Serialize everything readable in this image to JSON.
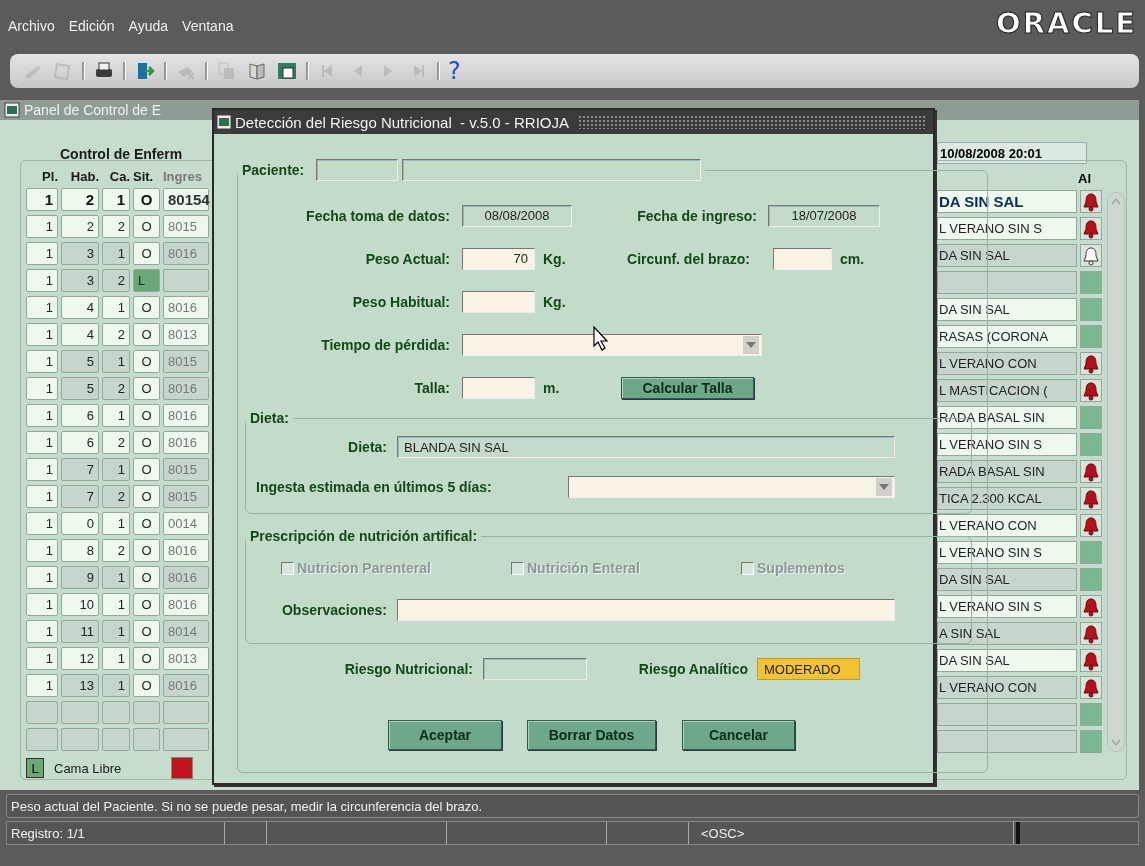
{
  "menu": [
    {
      "label": "Archivo"
    },
    {
      "label": "Edición"
    },
    {
      "label": "Ayuda"
    },
    {
      "label": "Ventana"
    }
  ],
  "logo": "ORACLE",
  "toolbar": [
    {
      "kind": "pen",
      "disabled": true
    },
    {
      "kind": "save",
      "disabled": true
    },
    {
      "kind": "separator"
    },
    {
      "kind": "print",
      "disabled": false
    },
    {
      "kind": "separator"
    },
    {
      "kind": "exit",
      "disabled": false
    },
    {
      "kind": "separator"
    },
    {
      "kind": "clear",
      "disabled": true
    },
    {
      "kind": "separator"
    },
    {
      "kind": "list",
      "disabled": true
    },
    {
      "kind": "book",
      "disabled": false
    },
    {
      "kind": "helpwindow",
      "disabled": false
    },
    {
      "kind": "separator"
    },
    {
      "kind": "first",
      "disabled": true
    },
    {
      "kind": "prev",
      "disabled": true
    },
    {
      "kind": "next",
      "disabled": true
    },
    {
      "kind": "last",
      "disabled": true
    },
    {
      "kind": "separator"
    },
    {
      "kind": "help",
      "label": "?",
      "disabled": false
    }
  ],
  "background_window": {
    "title": "Panel de Control de E",
    "group_title": "Control de Enferm",
    "datetime": "10/08/2008 20:01",
    "columns": [
      "Pl.",
      "Hab.",
      "Ca.",
      "Sit.",
      "Ingres"
    ],
    "alert_column": "Al",
    "rows": [
      {
        "kind": "patient",
        "pl": "1",
        "hab": "2",
        "ca": "1",
        "sit": "O",
        "ingreso": "80154",
        "dieta": "DA SIN SAL",
        "bell": true,
        "bell_filled": true,
        "current": true,
        "shaded": false,
        "free": false
      },
      {
        "kind": "patient",
        "pl": "1",
        "hab": "2",
        "ca": "2",
        "sit": "O",
        "ingreso": "8015",
        "dieta": "L VERANO SIN S",
        "bell": true,
        "bell_filled": true,
        "current": false,
        "shaded": false,
        "free": false
      },
      {
        "kind": "patient",
        "pl": "1",
        "hab": "3",
        "ca": "1",
        "sit": "O",
        "ingreso": "8016",
        "dieta": "DA SIN SAL",
        "bell": true,
        "bell_filled": false,
        "current": false,
        "shaded": true,
        "free": false
      },
      {
        "kind": "patient",
        "pl": "1",
        "hab": "3",
        "ca": "2",
        "sit": "L",
        "bell": false,
        "current": false,
        "shaded": true,
        "free": true
      },
      {
        "kind": "patient",
        "pl": "1",
        "hab": "4",
        "ca": "1",
        "sit": "O",
        "ingreso": "8016",
        "dieta": "DA SIN SAL",
        "bell": false,
        "current": false,
        "shaded": false,
        "free": false
      },
      {
        "kind": "patient",
        "pl": "1",
        "hab": "4",
        "ca": "2",
        "sit": "O",
        "ingreso": "8013",
        "dieta": "RASAS (CORONA",
        "bell": false,
        "current": false,
        "shaded": false,
        "free": false
      },
      {
        "kind": "patient",
        "pl": "1",
        "hab": "5",
        "ca": "1",
        "sit": "O",
        "ingreso": "8015",
        "dieta": "L VERANO CON",
        "bell": true,
        "bell_filled": true,
        "current": false,
        "shaded": true,
        "free": false
      },
      {
        "kind": "patient",
        "pl": "1",
        "hab": "5",
        "ca": "2",
        "sit": "O",
        "ingreso": "8016",
        "dieta": "L MASTICACION (",
        "bell": true,
        "bell_filled": true,
        "current": false,
        "shaded": true,
        "free": false
      },
      {
        "kind": "patient",
        "pl": "1",
        "hab": "6",
        "ca": "1",
        "sit": "O",
        "ingreso": "8016",
        "dieta": "RADA BASAL SIN",
        "bell": false,
        "current": false,
        "shaded": false,
        "free": false
      },
      {
        "kind": "patient",
        "pl": "1",
        "hab": "6",
        "ca": "2",
        "sit": "O",
        "ingreso": "8016",
        "dieta": "L VERANO SIN S",
        "bell": false,
        "current": false,
        "shaded": false,
        "free": false
      },
      {
        "kind": "patient",
        "pl": "1",
        "hab": "7",
        "ca": "1",
        "sit": "O",
        "ingreso": "8015",
        "dieta": "RADA BASAL SIN",
        "bell": true,
        "bell_filled": true,
        "current": false,
        "shaded": true,
        "free": false
      },
      {
        "kind": "patient",
        "pl": "1",
        "hab": "7",
        "ca": "2",
        "sit": "O",
        "ingreso": "8015",
        "dieta": "TICA 2.300 KCAL",
        "bell": true,
        "bell_filled": true,
        "current": false,
        "shaded": true,
        "free": false
      },
      {
        "kind": "patient",
        "pl": "1",
        "hab": "0",
        "ca": "1",
        "sit": "O",
        "ingreso": "0014",
        "dieta": "L VERANO CON",
        "bell": true,
        "bell_filled": true,
        "current": false,
        "shaded": false,
        "free": false
      },
      {
        "kind": "patient",
        "pl": "1",
        "hab": "8",
        "ca": "2",
        "sit": "O",
        "ingreso": "8016",
        "dieta": "L VERANO SIN S",
        "bell": false,
        "current": false,
        "shaded": false,
        "free": false
      },
      {
        "kind": "patient",
        "pl": "1",
        "hab": "9",
        "ca": "1",
        "sit": "O",
        "ingreso": "8016",
        "dieta": "DA SIN SAL",
        "bell": false,
        "current": false,
        "shaded": true,
        "free": false
      },
      {
        "kind": "patient",
        "pl": "1",
        "hab": "10",
        "ca": "1",
        "sit": "O",
        "ingreso": "8016",
        "dieta": "L VERANO SIN S",
        "bell": true,
        "bell_filled": true,
        "current": false,
        "shaded": false,
        "free": false
      },
      {
        "kind": "patient",
        "pl": "1",
        "hab": "11",
        "ca": "1",
        "sit": "O",
        "ingreso": "8014",
        "dieta": "A SIN SAL",
        "bell": true,
        "bell_filled": true,
        "current": false,
        "shaded": true,
        "free": false
      },
      {
        "kind": "patient",
        "pl": "1",
        "hab": "12",
        "ca": "1",
        "sit": "O",
        "ingreso": "8013",
        "dieta": "DA SIN SAL",
        "bell": true,
        "bell_filled": true,
        "current": false,
        "shaded": false,
        "free": false
      },
      {
        "kind": "patient",
        "pl": "1",
        "hab": "13",
        "ca": "1",
        "sit": "O",
        "ingreso": "8016",
        "dieta": "L VERANO CON",
        "bell": true,
        "bell_filled": true,
        "current": false,
        "shaded": true,
        "free": false
      },
      {
        "kind": "blank"
      },
      {
        "kind": "blank"
      }
    ],
    "legend": [
      {
        "kind": "free",
        "swatch": "L",
        "label": "Cama Libre"
      },
      {
        "kind": "alert"
      }
    ]
  },
  "dialog": {
    "title": "Detección del Riesgo Nutricional  - v.5.0 - RRIOJA",
    "patient_label": "Paciente:",
    "fecha_toma": {
      "label": "Fecha toma de datos:",
      "value": "08/08/2008",
      "readonly": true
    },
    "fecha_ingreso": {
      "label": "Fecha de ingreso:",
      "value": "18/07/2008",
      "readonly": true
    },
    "peso_actual": {
      "label": "Peso Actual:",
      "value": "70",
      "unit": "Kg.",
      "readonly": false
    },
    "circunferencia": {
      "label": "Circunf. del brazo:",
      "unit": "cm.",
      "readonly": false
    },
    "peso_habitual": {
      "label": "Peso Habitual:",
      "unit": "Kg.",
      "readonly": false
    },
    "tiempo_perdida": {
      "label": "Tiempo de pérdida:"
    },
    "talla": {
      "label": "Talla:",
      "unit": "m.",
      "readonly": false
    },
    "calcular_button": "Calcular Talla",
    "dieta_group": {
      "title": "Dieta:",
      "dieta": {
        "label": "Dieta:",
        "value": "BLANDA SIN SAL",
        "readonly": true
      },
      "ingesta": {
        "label": "Ingesta estimada en últimos 5 días:"
      }
    },
    "prescripcion_group": {
      "title": "Prescripción de nutrición artifical:",
      "checkboxes": [
        {
          "label": "Nutricion Parenteral",
          "checked": false,
          "disabled": true
        },
        {
          "label": "Nutrición Enteral",
          "checked": false,
          "disabled": true
        },
        {
          "label": "Suplementos",
          "checked": false,
          "disabled": true
        }
      ],
      "observaciones": {
        "label": "Observaciones:",
        "readonly": false
      }
    },
    "riesgo_nutricional": {
      "label": "Riesgo Nutricional:",
      "readonly": true
    },
    "riesgo_analitico": {
      "label": "Riesgo Analítico",
      "value": "MODERADO",
      "highlighted": true
    },
    "buttons": [
      {
        "label": "Aceptar"
      },
      {
        "label": "Borrar Datos"
      },
      {
        "label": "Cancelar"
      }
    ]
  },
  "status_bar": {
    "message": "Peso actual del Paciente. Si no se puede pesar, medir la circunferencia del brazo.",
    "record": "Registro: 1/1",
    "mode": "<OSC>"
  }
}
